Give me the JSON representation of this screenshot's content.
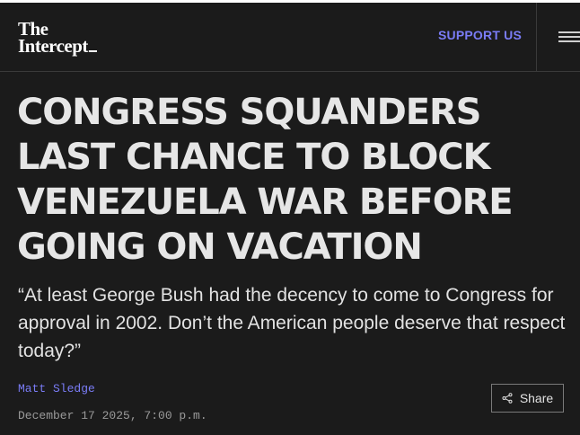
{
  "header": {
    "logo_line1": "The",
    "logo_line2": "Intercept",
    "support_label": "SUPPORT US",
    "menu_icon": "hamburger-icon"
  },
  "article": {
    "headline": "CONGRESS SQUANDERS LAST CHANCE TO BLOCK VENEZUELA WAR BEFORE GOING ON VACATION",
    "dek": "“At least George Bush had the decency to come to Congress for approval in 2002. Don’t the American people deserve that respect today?”",
    "author": "Matt Sledge",
    "date": "December 17 2025, 7:00 p.m.",
    "share_label": "Share",
    "share_icon": "share-icon"
  },
  "colors": {
    "background": "#1b1b1b",
    "accent": "#7a7cf6",
    "text": "#e6e6e6"
  }
}
